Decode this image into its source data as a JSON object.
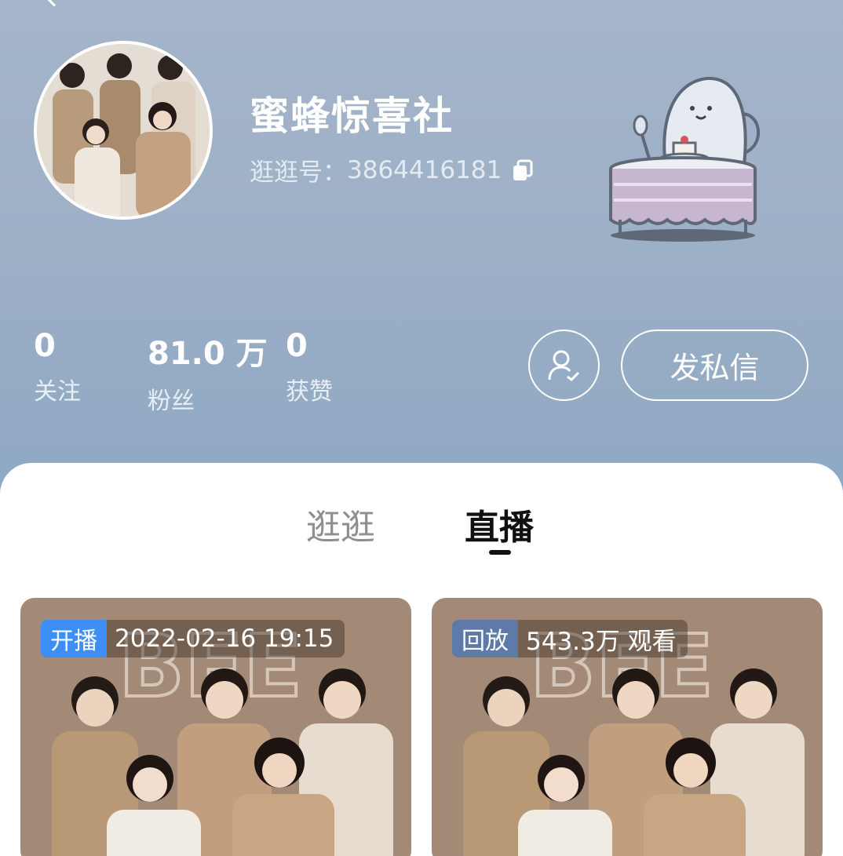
{
  "profile": {
    "name": "蜜蜂惊喜社",
    "id_label": "逛逛号：",
    "id_value": "3864416181"
  },
  "stats": [
    {
      "value": "0",
      "label": "关注"
    },
    {
      "value": "81.0 万",
      "label": "粉丝"
    },
    {
      "value": "0",
      "label": "获赞"
    }
  ],
  "actions": {
    "message_label": "发私信"
  },
  "tabs": [
    {
      "label": "逛逛",
      "active": false
    },
    {
      "label": "直播",
      "active": true
    }
  ],
  "cards": [
    {
      "badge": "开播",
      "info": "2022-02-16 19:15"
    },
    {
      "badge": "回放",
      "info": "543.3万 观看"
    }
  ],
  "colors": {
    "header_top": "#a4b5ca",
    "header_bottom": "#8ea8c3",
    "badge_live": "#3d8ff5",
    "badge_replay": "#5d7aa8"
  }
}
